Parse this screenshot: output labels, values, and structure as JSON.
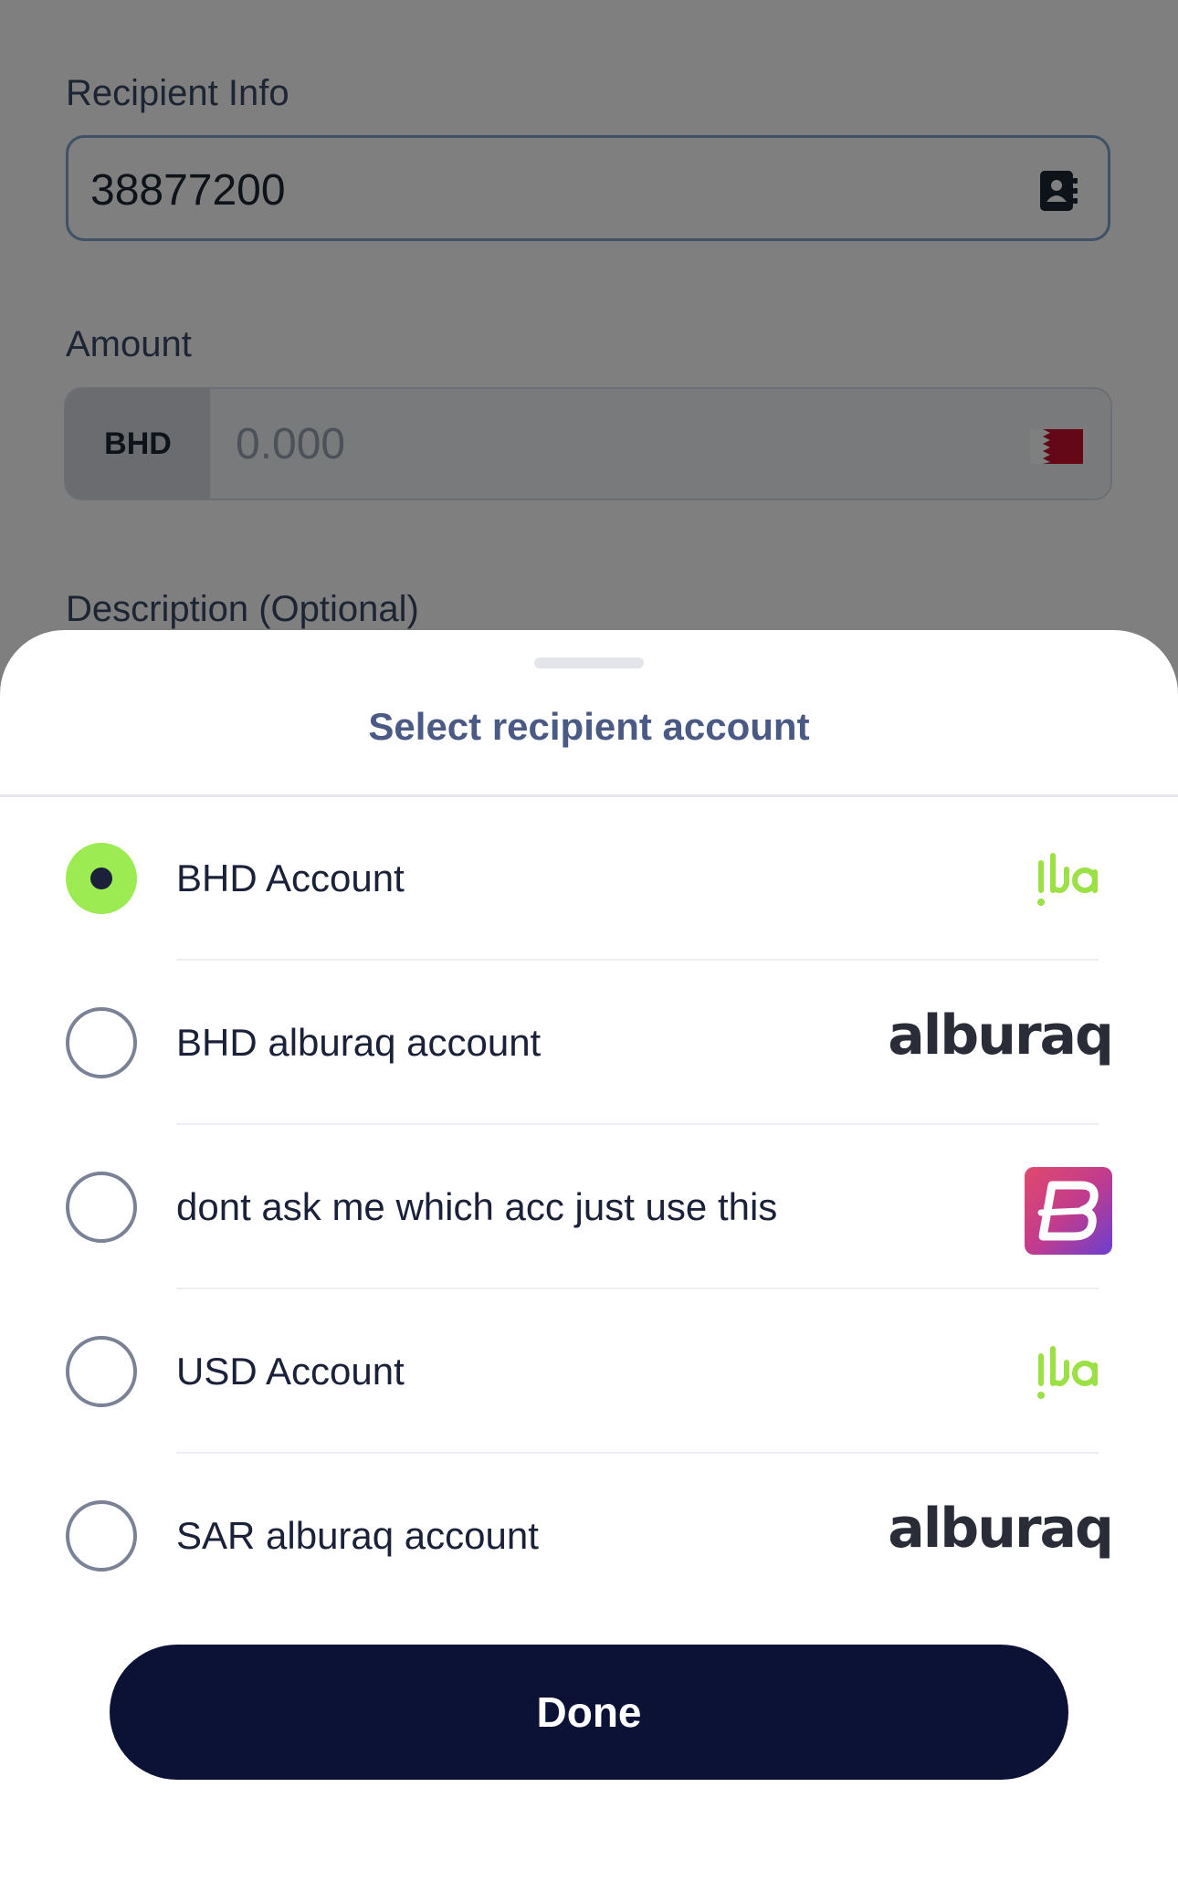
{
  "form": {
    "recipient_label": "Recipient Info",
    "recipient_value": "38877200",
    "amount_label": "Amount",
    "currency": "BHD",
    "amount_placeholder": "0.000",
    "description_label": "Description (Optional)"
  },
  "sheet": {
    "title": "Select recipient account",
    "accounts": [
      {
        "label": "BHD Account",
        "selected": true,
        "logo": "ila-logo"
      },
      {
        "label": "BHD alburaq account",
        "selected": false,
        "logo": "alburaq-logo",
        "logo_text": "alburaq"
      },
      {
        "label": "dont ask me which acc just use this",
        "selected": false,
        "logo": "b-bank-logo"
      },
      {
        "label": "USD Account",
        "selected": false,
        "logo": "ila-logo"
      },
      {
        "label": "SAR alburaq account",
        "selected": false,
        "logo": "alburaq-logo",
        "logo_text": "alburaq"
      }
    ],
    "done_label": "Done"
  },
  "colors": {
    "selected_radio": "#9deb53",
    "primary_button": "#0b1236",
    "ila_brand": "#9be044",
    "sheet_title": "#4a5a85"
  }
}
